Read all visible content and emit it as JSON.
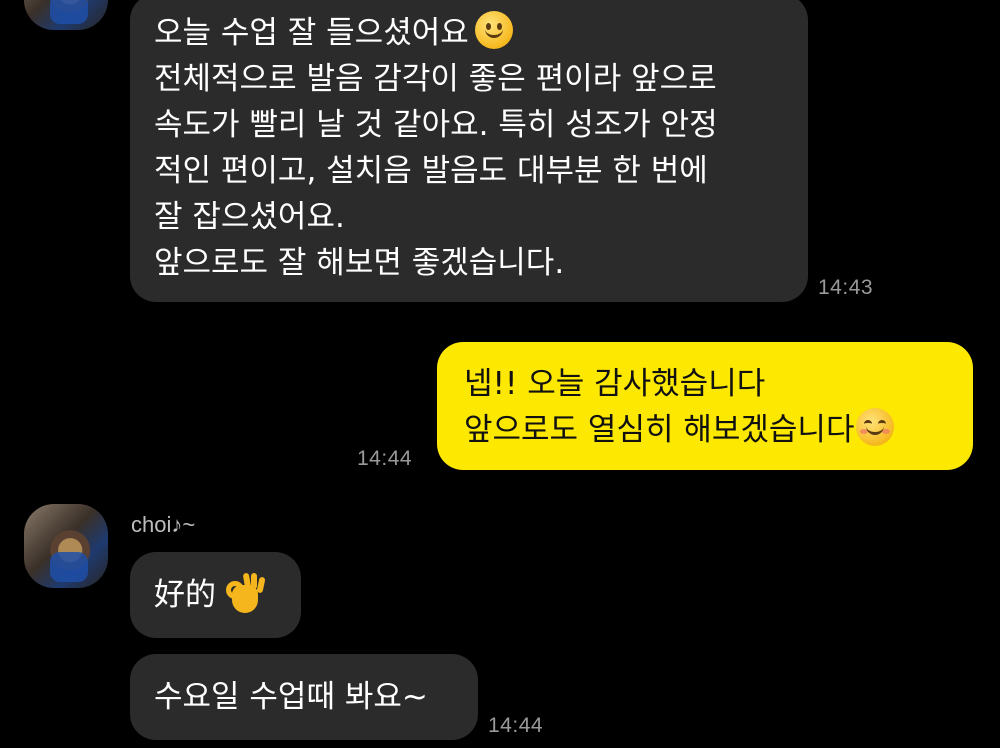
{
  "messages": [
    {
      "sender": "other",
      "lines": [
        "오늘 수업 잘 들으셨어요",
        "전체적으로 발음 감각이 좋은 편이라 앞으로",
        "속도가 빨리 날 것 같아요. 특히 성조가 안정",
        "적인 편이고, 설치음 발음도 대부분 한 번에",
        "잘 잡으셨어요.",
        "앞으로도 잘 해보면 좋겠습니다."
      ],
      "emoji": "slight-smile-icon",
      "time": "14:43"
    },
    {
      "sender": "me",
      "lines": [
        "넵!! 오늘 감사했습니다",
        "앞으로도 열심히 해보겠습니다"
      ],
      "emoji": "smiling-blush-icon",
      "time": "14:44"
    },
    {
      "sender": "other",
      "name": "choi♪~",
      "lines": [
        "好的"
      ],
      "emoji": "ok-hand-icon"
    },
    {
      "sender": "other",
      "lines": [
        "수요일 수업때 봐요~"
      ],
      "time": "14:44"
    }
  ],
  "colors": {
    "background": "#000000",
    "other_bubble": "#2b2b2b",
    "my_bubble": "#fde801",
    "timestamp": "#9a9a9a"
  }
}
